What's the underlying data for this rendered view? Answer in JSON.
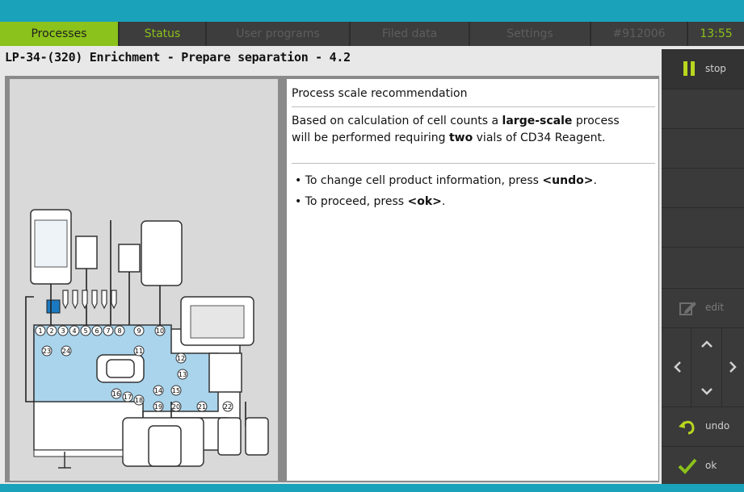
{
  "tabs": [
    {
      "label": "Processes",
      "state": "active"
    },
    {
      "label": "Status",
      "state": "highlight"
    },
    {
      "label": "User programs",
      "state": "disabled"
    },
    {
      "label": "Filed data",
      "state": "disabled"
    },
    {
      "label": "Settings",
      "state": "disabled"
    },
    {
      "label": "#912006",
      "state": "disabled"
    },
    {
      "label": "13:55",
      "state": "clock"
    }
  ],
  "page_title": "LP-34-(320) Enrichment - Prepare separation - 4.2",
  "content": {
    "heading": "Process scale recommendation",
    "para_a": "Based on calculation of cell counts a ",
    "para_bold1": "large-scale",
    "para_b": " process",
    "para_c": "will be performed requiring ",
    "para_bold2": "two",
    "para_d": " vials of CD34 Reagent.",
    "bullet1_a": "• To change cell product information, press ",
    "bullet1_bold": "<undo>",
    "bullet1_b": ".",
    "bullet2_a": "• To proceed, press ",
    "bullet2_bold": "<ok>",
    "bullet2_b": "."
  },
  "sidebar": {
    "stop_label": "stop",
    "edit_label": "edit",
    "undo_label": "undo",
    "ok_label": "ok"
  },
  "diagram_port_numbers": [
    "1",
    "2",
    "3",
    "4",
    "5",
    "6",
    "7",
    "8",
    "9",
    "10",
    "11",
    "12",
    "13",
    "14",
    "15",
    "16",
    "17",
    "18",
    "19",
    "20",
    "21",
    "22",
    "23",
    "24"
  ],
  "colors": {
    "accent_teal": "#1aa2ba",
    "accent_green": "#8bc21b",
    "panel_dark": "#3d3d3d",
    "diagram_blue": "#a9d4ec"
  }
}
